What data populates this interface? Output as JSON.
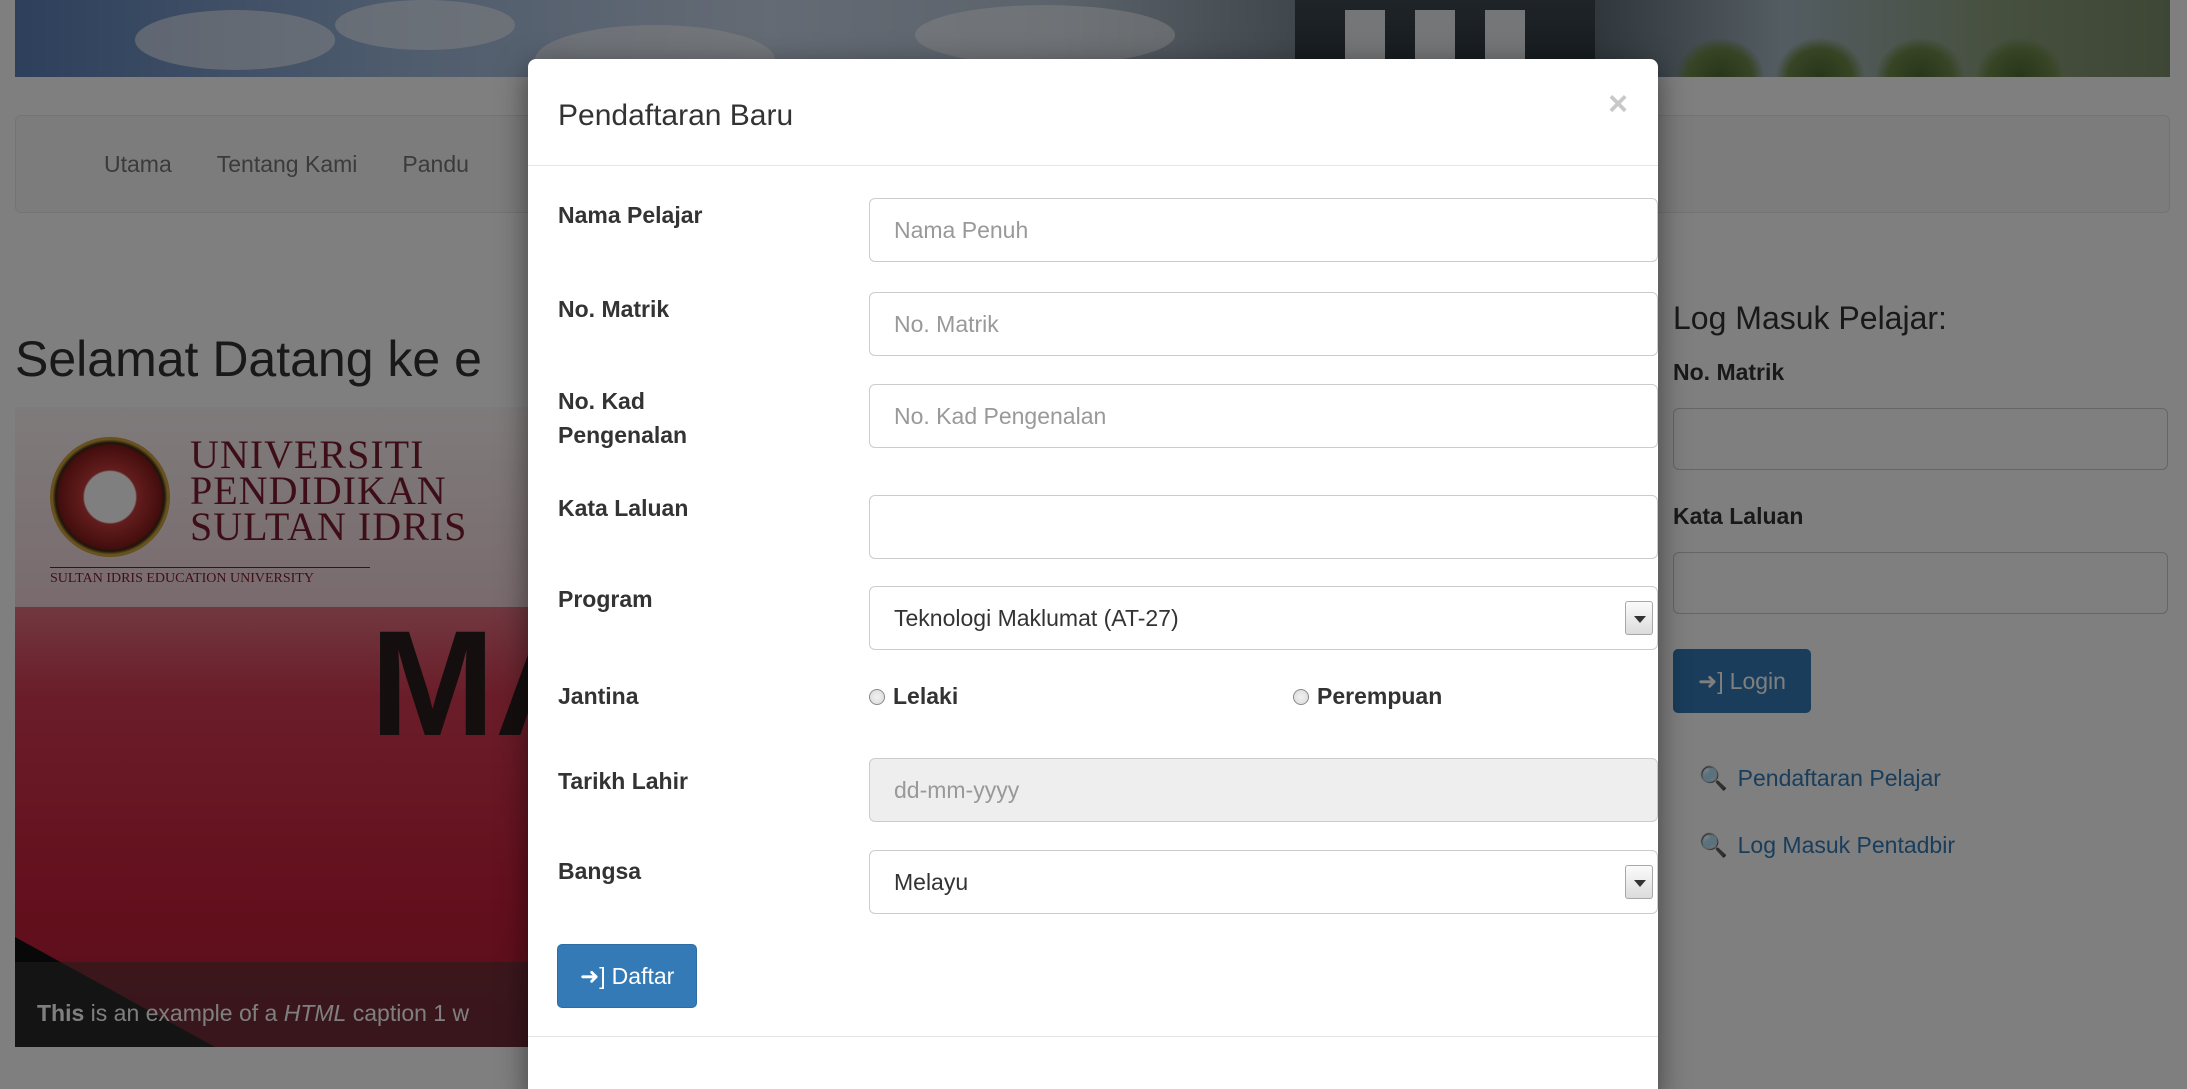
{
  "background": {
    "nav_items": [
      "Utama",
      "Tentang Kami",
      "Pandu"
    ],
    "welcome_text": "Selamat Datang ke e",
    "carousel": {
      "uni_line1": "UNIVERSITI",
      "uni_line2": "PENDIDIKAN",
      "uni_line3": "SULTAN IDRIS",
      "uni_subtitle": "SULTAN IDRIS EDUCATION UNIVERSITY",
      "big_text": "MA",
      "caption_bold": "This",
      "caption_mid": " is an example of a ",
      "caption_italic": "HTML",
      "caption_end": " caption 1 w"
    },
    "login": {
      "heading": "Log Masuk Pelajar:",
      "matrik_label": "No. Matrik",
      "password_label": "Kata Laluan",
      "login_button": "Login",
      "link_register": "Pendaftaran Pelajar",
      "link_admin": "Log Masuk Pentadbir"
    }
  },
  "modal": {
    "title": "Pendaftaran Baru",
    "close_symbol": "×",
    "fields": {
      "nama": {
        "label": "Nama Pelajar",
        "placeholder": "Nama Penuh"
      },
      "matrik": {
        "label": "No. Matrik",
        "placeholder": "No. Matrik"
      },
      "kad_line1": "No. Kad",
      "kad_line2": "Pengenalan",
      "kad_placeholder": "No. Kad Pengenalan",
      "kata_laluan": {
        "label": "Kata Laluan",
        "value": ""
      },
      "program": {
        "label": "Program",
        "value": "Teknologi Maklumat (AT-27)"
      },
      "jantina": {
        "label": "Jantina",
        "option1": "Lelaki",
        "option2": "Perempuan"
      },
      "tarikh": {
        "label": "Tarikh Lahir",
        "placeholder": "dd-mm-yyyy"
      },
      "bangsa": {
        "label": "Bangsa",
        "value": "Melayu"
      }
    },
    "submit_label": "Daftar"
  },
  "icons": {
    "login_icon": "sign-in-icon",
    "link_icon": "key-icon"
  },
  "colors": {
    "primary": "#337ab7",
    "backdrop": "rgba(0,0,0,0.5)"
  }
}
